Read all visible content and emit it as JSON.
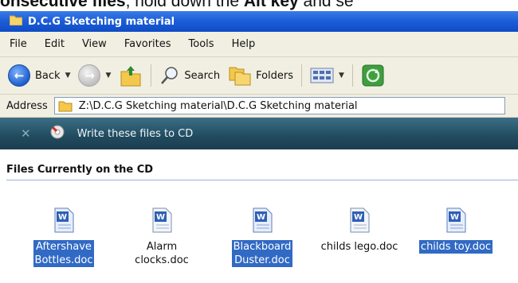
{
  "caption": {
    "part1": "onsecutive files",
    "part2": ", hold down the ",
    "part3": "Alt key",
    "part4": " and se"
  },
  "window": {
    "title": "D.C.G Sketching material"
  },
  "menu": [
    "File",
    "Edit",
    "View",
    "Favorites",
    "Tools",
    "Help"
  ],
  "toolbar": {
    "back_label": "Back",
    "search_label": "Search",
    "folders_label": "Folders"
  },
  "address": {
    "label": "Address",
    "path": "Z:\\D.C.G Sketching material\\D.C.G Sketching material"
  },
  "cd_task": {
    "label": "Write these files to CD"
  },
  "files_section": {
    "heading": "Files Currently on the CD",
    "files": [
      {
        "line1": "Aftershave",
        "line2": "Bottles.doc",
        "selected": true
      },
      {
        "line1": "Alarm",
        "line2": "clocks.doc",
        "selected": false
      },
      {
        "line1": "Blackboard",
        "line2": "Duster.doc",
        "selected": true
      },
      {
        "line1": "childs lego.doc",
        "line2": "",
        "selected": false
      },
      {
        "line1": "childs toy.doc",
        "line2": "",
        "selected": true
      }
    ]
  },
  "colors": {
    "titlebar": "#1d5fd8",
    "selection": "#316ac5",
    "cd_bar": "#214a5e"
  }
}
